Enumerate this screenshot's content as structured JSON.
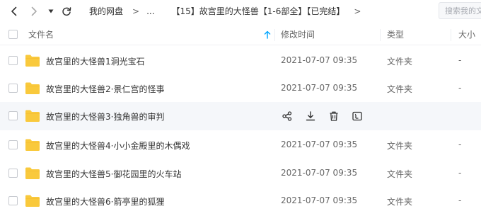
{
  "toolbar": {
    "back_icon": "chevron-left-icon",
    "forward_icon": "chevron-right-icon",
    "history_icon": "caret-down-icon",
    "refresh_icon": "refresh-icon",
    "breadcrumb": [
      "我的网盘",
      "...",
      "【15】故宫里的大怪兽【1-6部全】【已完结】"
    ],
    "separator": ">",
    "search_placeholder": "搜索我的文件"
  },
  "table": {
    "columns": {
      "name": "文件名",
      "modified": "修改时间",
      "type": "类型",
      "size": "大小"
    },
    "sort_icon": "arrow-up-icon",
    "rows": [
      {
        "name": "故宫里的大怪兽1洞光宝石",
        "modified": "2021-07-07 09:35",
        "type": "文件夹",
        "size": "-"
      },
      {
        "name": "故宫里的大怪兽2·景仁宫的怪事",
        "modified": "2021-07-07 09:35",
        "type": "文件夹",
        "size": "-"
      },
      {
        "name": "故宫里的大怪兽3·独角兽的审判",
        "modified": "",
        "type": "",
        "size": "",
        "hovered": true
      },
      {
        "name": "故宫里的大怪兽4·小小金殿里的木偶戏",
        "modified": "2021-07-07 09:35",
        "type": "文件夹",
        "size": "-"
      },
      {
        "name": "故宫里的大怪兽5·御花园里的火车站",
        "modified": "2021-07-07 09:35",
        "type": "文件夹",
        "size": "-"
      },
      {
        "name": "故宫里的大怪兽6·箭亭里的狐狸",
        "modified": "2021-07-07 09:35",
        "type": "文件夹",
        "size": "-"
      }
    ],
    "row_actions": [
      "share-icon",
      "download-icon",
      "delete-icon",
      "more-icon"
    ]
  },
  "colors": {
    "folder": "#f9c93c",
    "folder_tab": "#f5b82e",
    "accent": "#06a7ff",
    "hover_bg": "#f5f7fa"
  }
}
